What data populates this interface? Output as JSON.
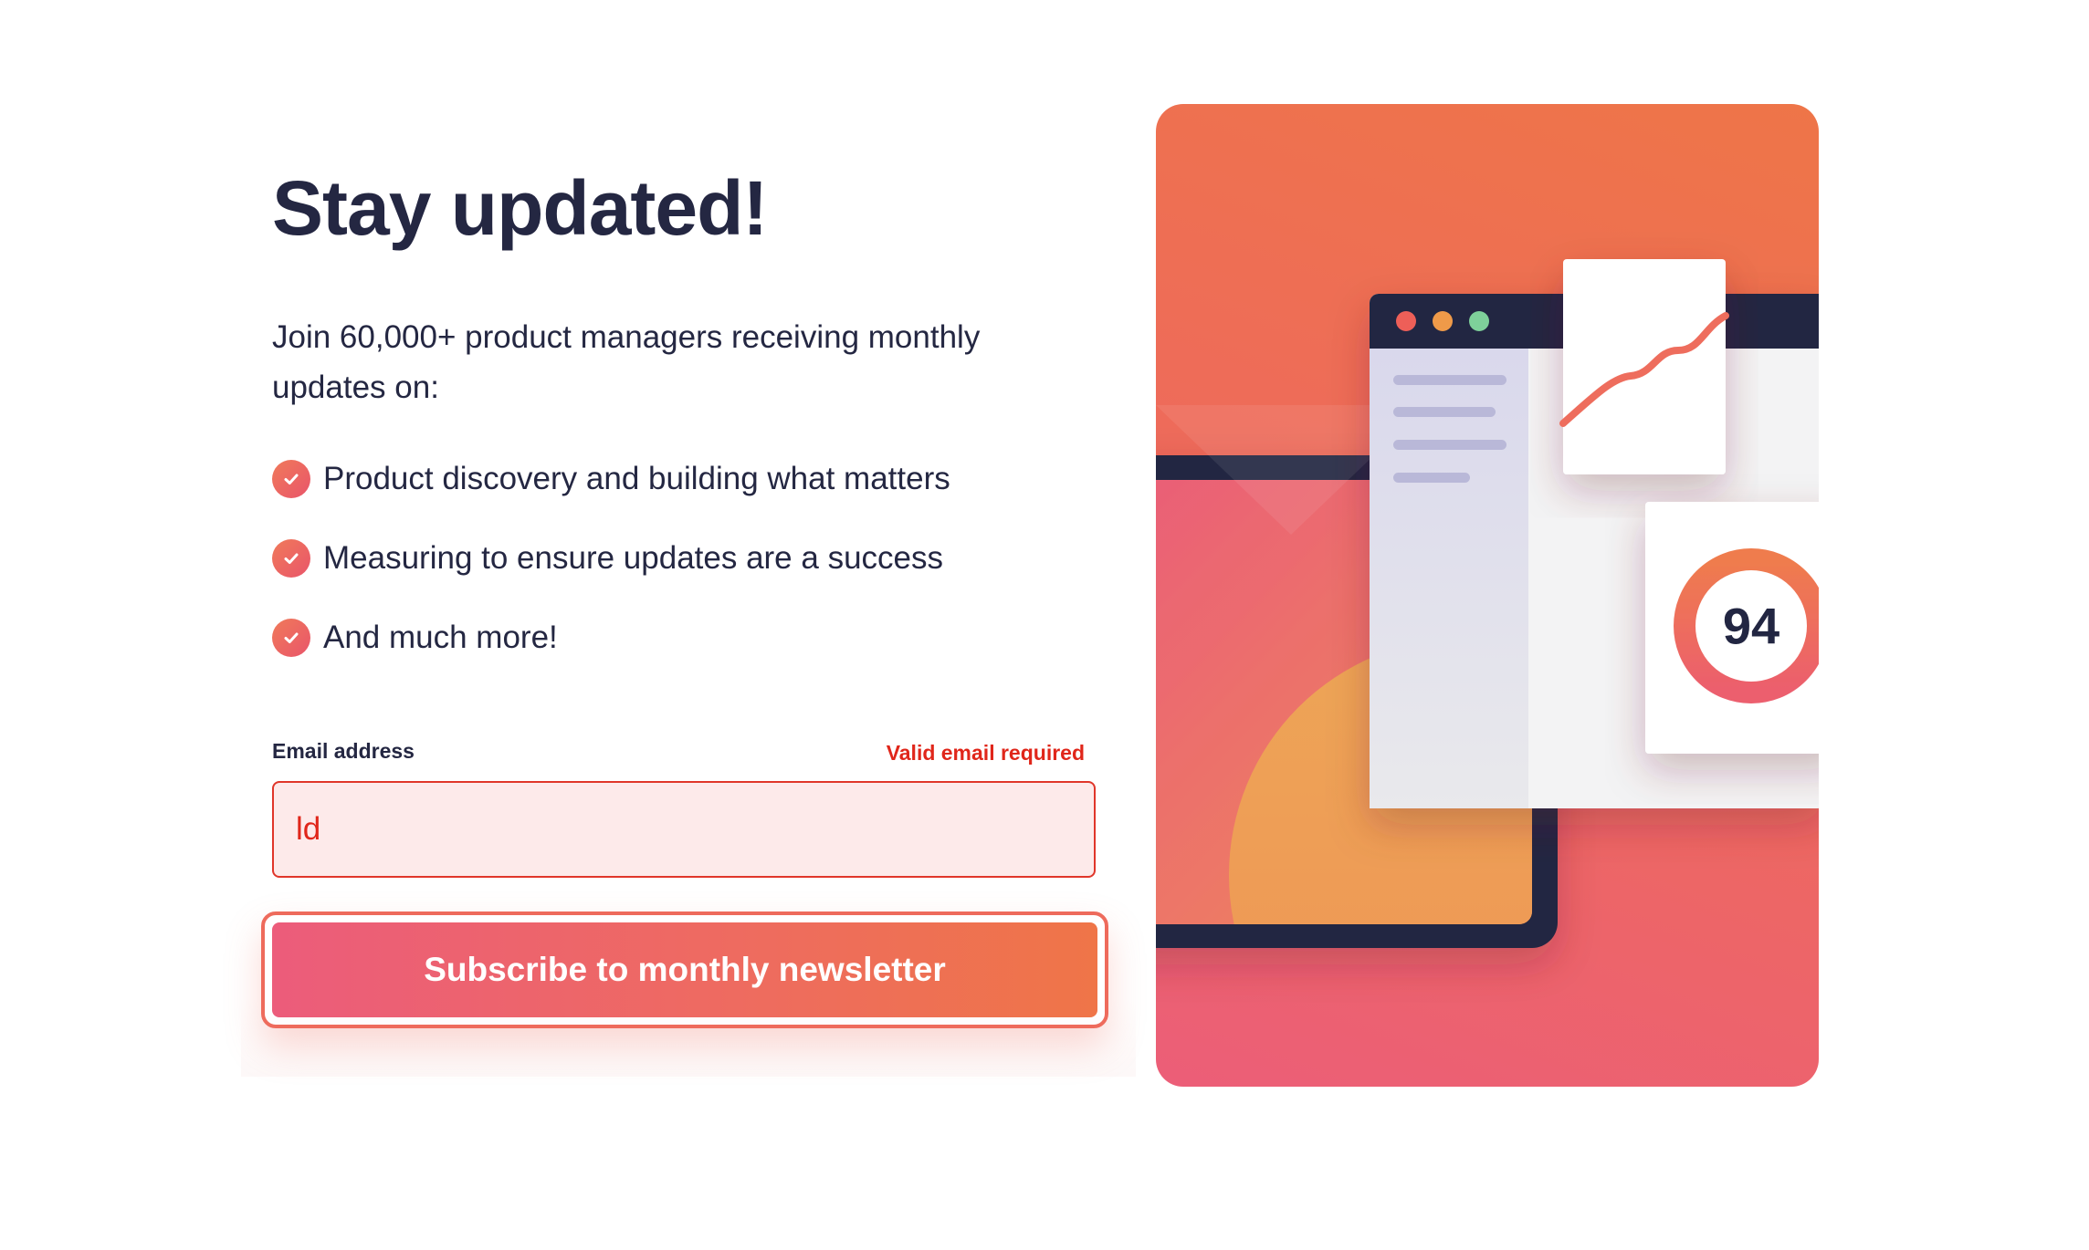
{
  "headline": "Stay updated!",
  "intro": "Join 60,000+ product managers receiving monthly updates on:",
  "benefits": [
    "Product discovery and building what matters",
    "Measuring to ensure updates are a success",
    "And much more!"
  ],
  "form": {
    "email_label": "Email address",
    "error_message": "Valid email required",
    "email_value": "ld",
    "submit_label": "Subscribe to monthly newsletter"
  },
  "illustration": {
    "score": "94"
  },
  "colors": {
    "text": "#242742",
    "error": "#e0261a",
    "error_bg": "#fdeaea",
    "accent_start": "#ec5c7b",
    "accent_end": "#ef7548"
  },
  "icons": {
    "benefit_check": "check-circle-icon"
  }
}
